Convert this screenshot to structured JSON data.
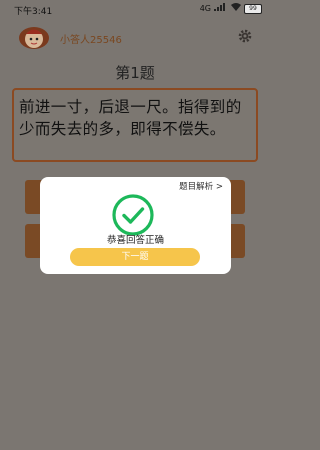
{
  "status": {
    "time": "下午3:41",
    "signal": "4G",
    "battery": "99"
  },
  "header": {
    "username": "小答人25546"
  },
  "question": {
    "number_label": "第1题",
    "text": "前进一寸，后退一尺。指得到的少而失去的多，即得不偿失。"
  },
  "dialog": {
    "analysis_label": "题目解析 >",
    "message": "恭喜回答正确",
    "next_label": "下一题"
  },
  "colors": {
    "accent": "#f6c54b",
    "brown": "#7a4a25",
    "success": "#1db85a",
    "border": "#8b4a22"
  },
  "icons": [
    "avatar-icon",
    "gear-icon",
    "check-circle-icon"
  ]
}
